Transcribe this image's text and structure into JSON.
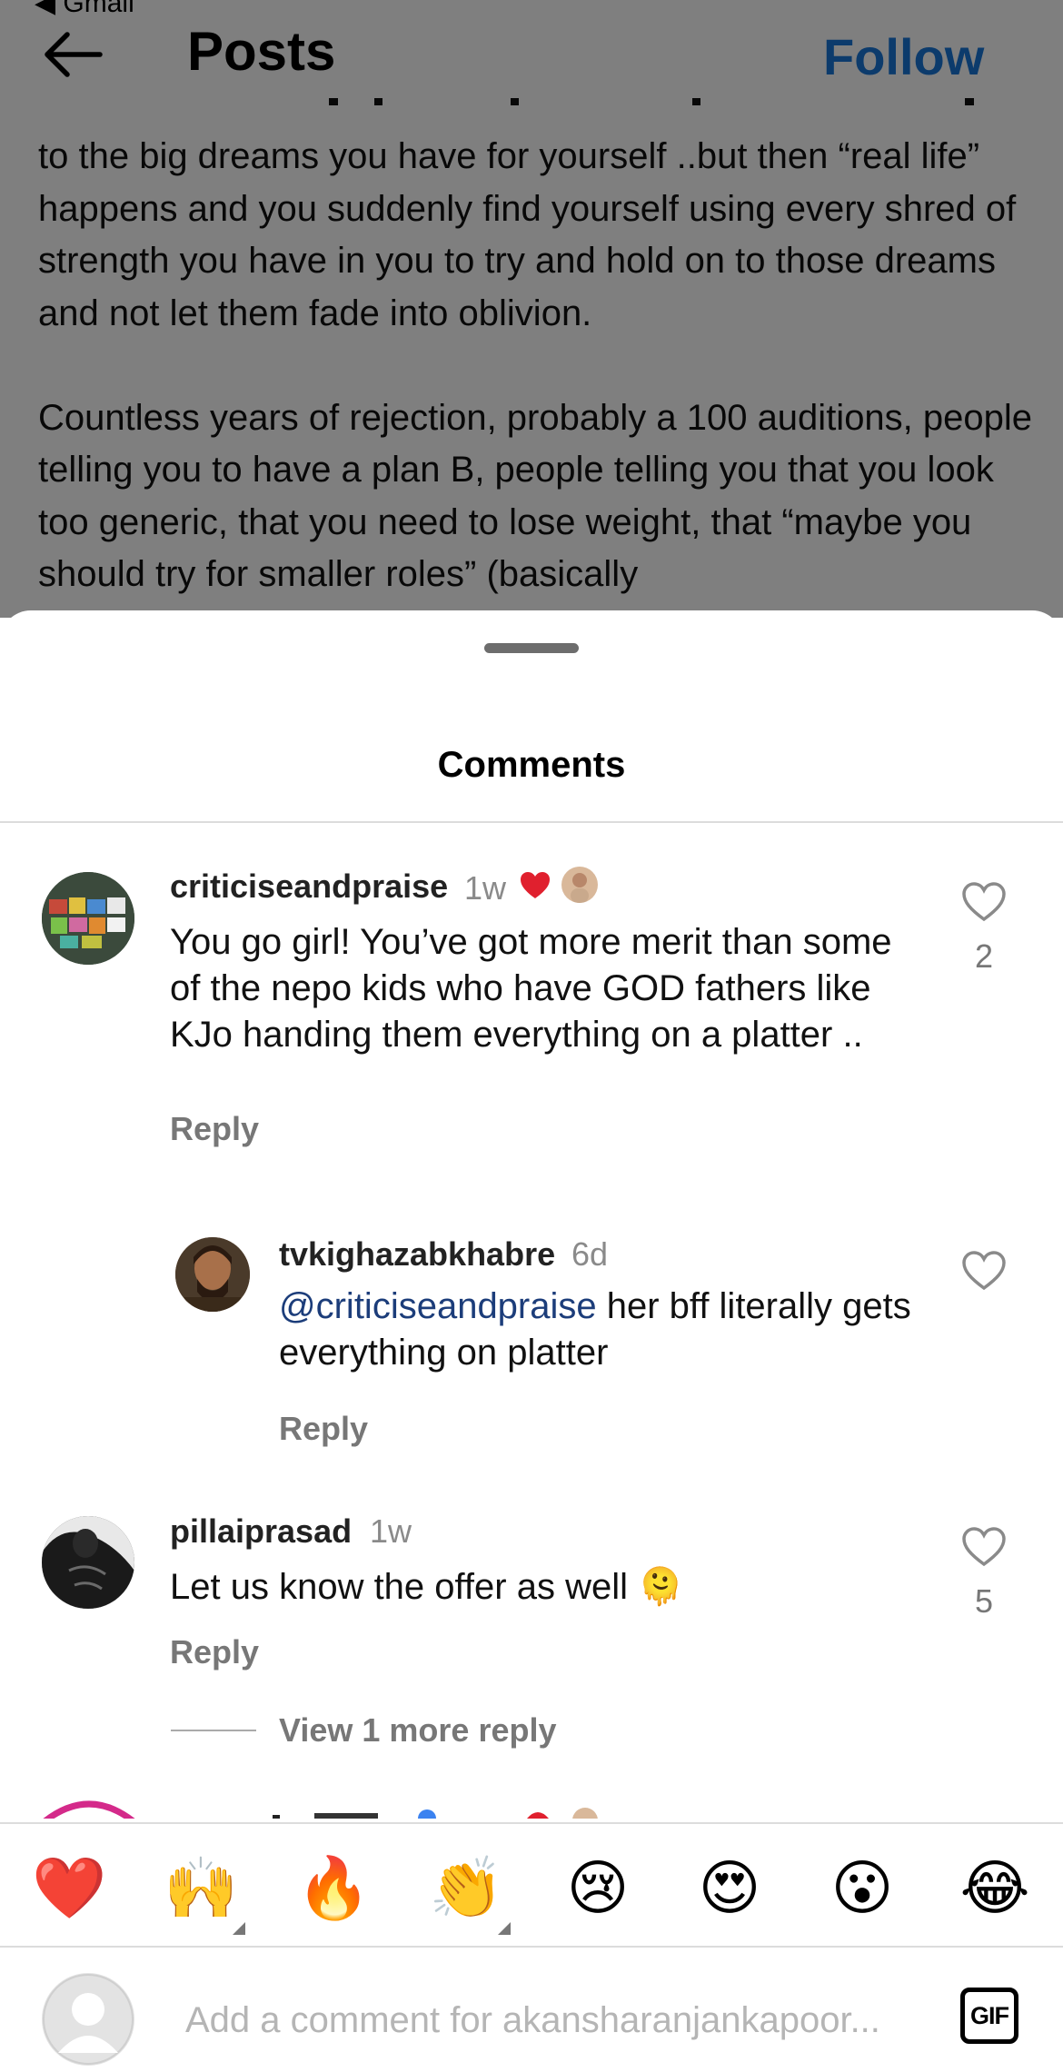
{
  "status_bar": {
    "back_app": "◀ Gmail"
  },
  "header": {
    "title": "Posts",
    "follow_label": "Follow"
  },
  "post": {
    "text": "to the big dreams you have for yourself ..but then “real life” happens and you suddenly find yourself using every shred of strength you have in you to try and hold on to those dreams and not let them fade into oblivion.\n\nCountless years of rejection, probably a 100 auditions, people telling you to have a plan B, people telling you that you look too generic, that you need to lose weight, that “maybe you should try for smaller roles” (basically"
  },
  "comments_sheet": {
    "title": "Comments",
    "comments": [
      {
        "username": "criticiseandpraise",
        "time": "1w",
        "text": "You go girl! You’ve got more merit than some of the nepo kids who have GOD fathers like KJo handing them everything on a platter ..",
        "reply_label": "Reply",
        "likes": "2"
      },
      {
        "username": "tvkighazabkhabre",
        "time": "6d",
        "mention": "@criticiseandpraise",
        "text": " her bff literally gets everything on platter",
        "reply_label": "Reply"
      },
      {
        "username": "pillaiprasad",
        "time": "1w",
        "text": "Let us know the offer as well 🫠",
        "reply_label": "Reply",
        "likes": "5",
        "view_more": "View 1 more reply"
      }
    ]
  },
  "emoji_bar": [
    "❤️",
    "🙌",
    "🔥",
    "👏",
    "😢",
    "😍",
    "😮",
    "😂"
  ],
  "composer": {
    "placeholder": "Add a comment for akansharanjankapoor...",
    "gif_label": "GIF"
  },
  "colors": {
    "accent": "#1877d9",
    "heart": "#e0202e",
    "mention": "#1c3d7a"
  }
}
